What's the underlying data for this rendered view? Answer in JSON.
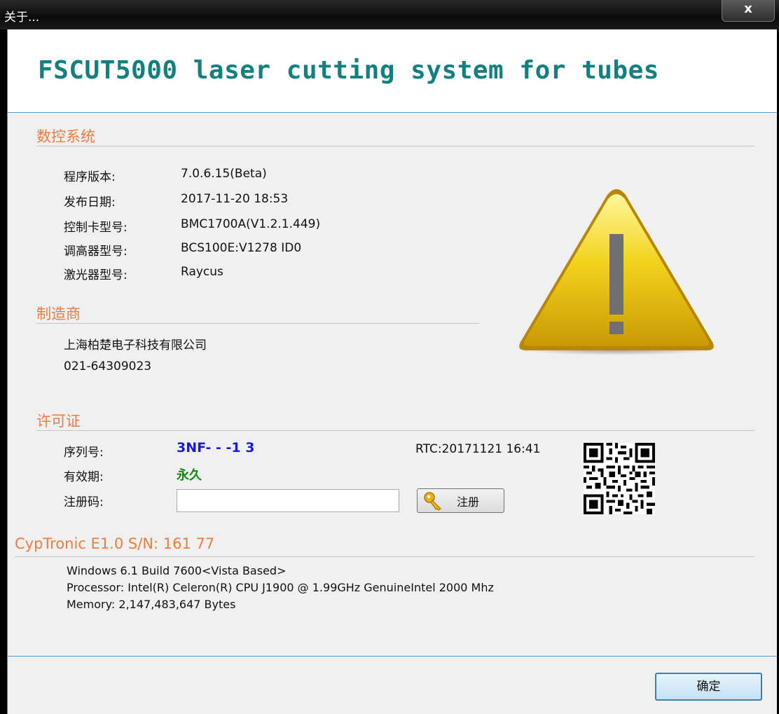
{
  "window": {
    "title": "关于...",
    "close_label": "x"
  },
  "header": {
    "app_title": "FSCUT5000 laser cutting system for tubes"
  },
  "cnc": {
    "section_title": "数控系统",
    "fields": [
      {
        "label": "程序版本:",
        "value": "7.0.6.15(Beta)"
      },
      {
        "label": "发布日期:",
        "value": "2017-11-20 18:53"
      },
      {
        "label": "控制卡型号:",
        "value": "BMC1700A(V1.2.1.449)"
      },
      {
        "label": "调高器型号:",
        "value": "BCS100E:V1278 ID0"
      },
      {
        "label": "激光器型号:",
        "value": "Raycus"
      }
    ]
  },
  "manufacturer": {
    "section_title": "制造商",
    "name": "上海柏楚电子科技有限公司",
    "phone": "021-64309023"
  },
  "license": {
    "section_title": "许可证",
    "serial_label": "序列号:",
    "serial_value": "3NF-  -   -1    3",
    "rtc": "RTC:20171121 16:41",
    "validity_label": "有效期:",
    "validity_value": "永久",
    "regcode_label": "注册码:",
    "regcode_value": "",
    "register_button": "注册"
  },
  "device": {
    "section_title": "CypTronic E1.0  S/N: 161      77",
    "lines": [
      "Windows 6.1 Build 7600<Vista Based>",
      "Processor: Intel(R) Celeron(R) CPU J1900 @ 1.99GHz GenuineIntel 2000 Mhz",
      "Memory: 2,147,483,647 Bytes"
    ]
  },
  "footer": {
    "ok_button": "确定"
  },
  "colors": {
    "title_teal": "#137f7f",
    "section_orange": "#f07c40",
    "serial_blue": "#1a1adc",
    "validity_green": "#128a12"
  },
  "icons": {
    "warning": "warning-triangle-icon",
    "key": "key-icon",
    "qr": "qr-code-icon"
  }
}
